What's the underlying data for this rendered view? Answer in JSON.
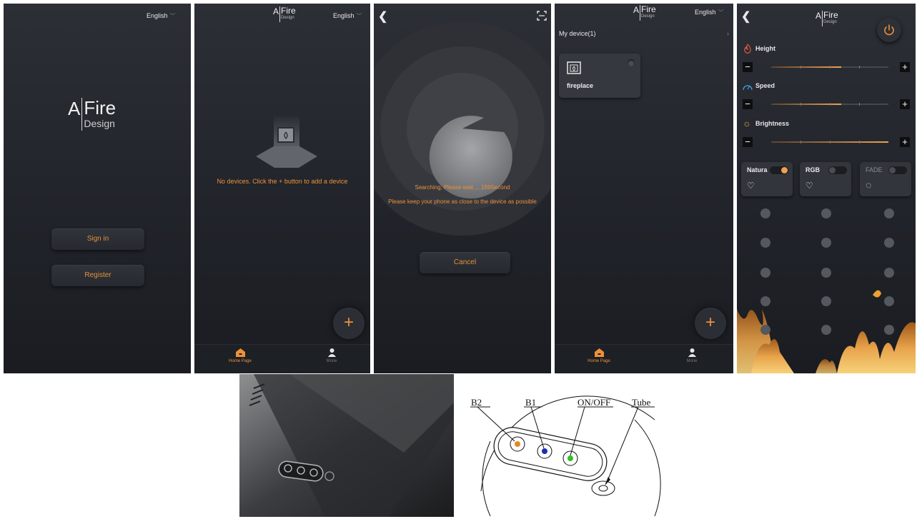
{
  "colors": {
    "accent": "#ef9139",
    "background": "#23262c"
  },
  "screen1": {
    "language": "English",
    "logo_letter": "A",
    "logo_word": "Fire",
    "logo_sub": "Design",
    "sign_in": "Sign in",
    "register": "Register"
  },
  "screen2": {
    "logo_letter": "A",
    "logo_word": "Fire",
    "logo_sub": "Design",
    "language": "English",
    "empty_message": "No devices. Click the + button to add a device",
    "add": "+",
    "tabs": [
      {
        "label": "Home Page",
        "icon": "home-icon"
      },
      {
        "label": "Mone",
        "icon": "user-icon"
      }
    ]
  },
  "screen3": {
    "line1": "Searching, Please wait.....159Second",
    "line2": "Please keep your phone as close to the device as possible",
    "cancel": "Cancel",
    "scan_icon": "scan-icon"
  },
  "screen4": {
    "logo_letter": "A",
    "logo_word": "Fire",
    "logo_sub": "Design",
    "language": "English",
    "my_device": "My device(1)",
    "device_name": "fireplace",
    "add": "+",
    "tabs": [
      {
        "label": "Home Page",
        "icon": "home-icon"
      },
      {
        "label": "Mone",
        "icon": "user-icon"
      }
    ]
  },
  "screen5": {
    "logo_letter": "A",
    "logo_word": "Fire",
    "logo_sub": "Design",
    "sliders": [
      {
        "label": "Height",
        "icon": "flame-icon",
        "value": 0.6
      },
      {
        "label": "Speed",
        "icon": "gauge-icon",
        "value": 0.6
      },
      {
        "label": "Brightness",
        "icon": "sun-icon",
        "value": 1.0
      }
    ],
    "minus": "−",
    "plus": "+",
    "modes": [
      {
        "label": "Natura",
        "on": true,
        "icon": "bulb-icon"
      },
      {
        "label": "RGB",
        "on": false,
        "icon": "bulb-icon"
      },
      {
        "label": "FADE",
        "on": false,
        "icon": "dotted-circle-icon"
      }
    ]
  },
  "diagram": {
    "labels": [
      "B2",
      "B1",
      "ON/OFF",
      "Tube"
    ]
  }
}
